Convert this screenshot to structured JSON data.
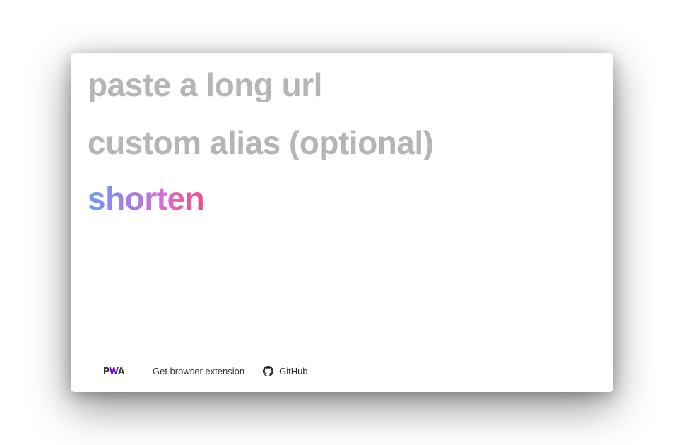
{
  "form": {
    "url_placeholder": "paste a long url",
    "url_value": "",
    "alias_placeholder": "custom alias (optional)",
    "alias_value": "",
    "submit_label": "shorten",
    "submit_gradient": [
      "#6aa0ea",
      "#a37bea",
      "#d96dd0",
      "#ea4f86"
    ]
  },
  "footer": {
    "pwa_badge_icon": "pwa-logo-icon",
    "extension_label": "Get browser extension",
    "github_icon": "github-icon",
    "github_label": "GitHub"
  },
  "colors": {
    "placeholder": "#b5b5b5",
    "footer_text": "#333333",
    "pwa_dark": "#3d3d3d",
    "pwa_purple": "#5a0fc8"
  }
}
